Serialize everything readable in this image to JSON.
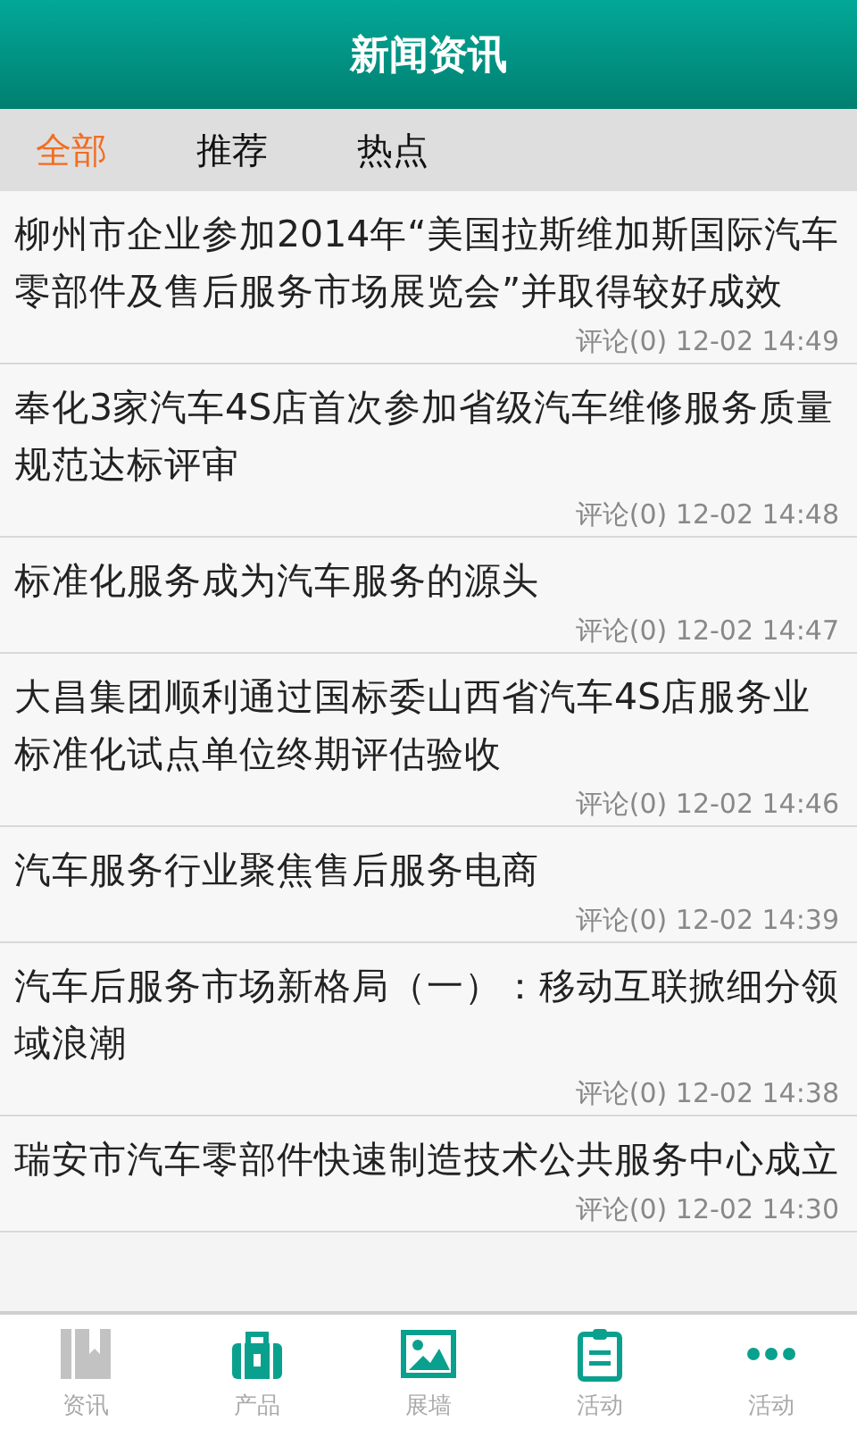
{
  "header": {
    "title": "新闻资讯"
  },
  "tabs": [
    {
      "label": "全部",
      "selected": true
    },
    {
      "label": "推荐",
      "selected": false
    },
    {
      "label": "热点",
      "selected": false
    }
  ],
  "news": [
    {
      "title": "柳州市企业参加2014年“美国拉斯维加斯国际汽车零部件及售后服务市场展览会”并取得较好成效",
      "meta": "评论(0) 12-02 14:49"
    },
    {
      "title": "奉化3家汽车4S店首次参加省级汽车维修服务质量规范达标评审",
      "meta": "评论(0) 12-02 14:48"
    },
    {
      "title": "标准化服务成为汽车服务的源头",
      "meta": "评论(0) 12-02 14:47"
    },
    {
      "title": "大昌集团顺利通过国标委山西省汽车4S店服务业标准化试点单位终期评估验收",
      "meta": "评论(0) 12-02 14:46"
    },
    {
      "title": "汽车服务行业聚焦售后服务电商",
      "meta": "评论(0) 12-02 14:39"
    },
    {
      "title": "汽车后服务市场新格局（一）：移动互联掀细分领域浪潮",
      "meta": "评论(0) 12-02 14:38"
    },
    {
      "title": "瑞安市汽车零部件快速制造技术公共服务中心成立",
      "meta": "评论(0) 12-02 14:30"
    }
  ],
  "bottom_nav": [
    {
      "kind": "news",
      "label": "资讯",
      "selected": true
    },
    {
      "kind": "product",
      "label": "产品",
      "selected": false
    },
    {
      "kind": "gallery",
      "label": "展墙",
      "selected": false
    },
    {
      "kind": "activity",
      "label": "活动",
      "selected": false
    },
    {
      "kind": "more",
      "label": "活动",
      "selected": false
    }
  ]
}
